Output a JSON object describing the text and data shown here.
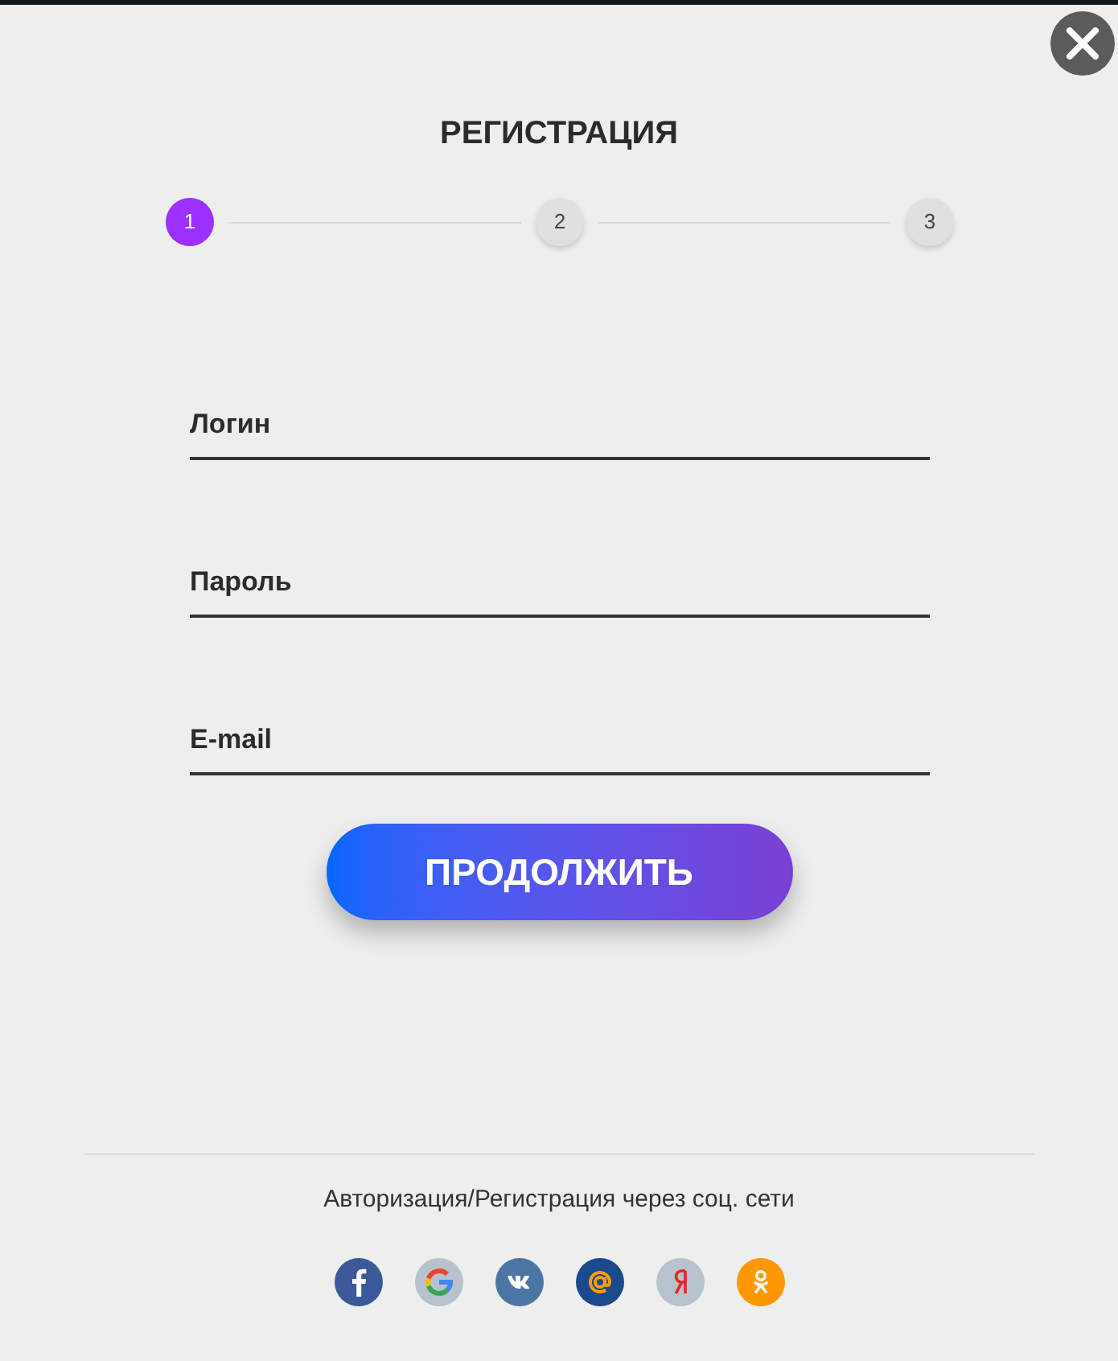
{
  "title": "РЕГИСТРАЦИЯ",
  "steps": [
    {
      "label": "1",
      "selected": true
    },
    {
      "label": "2",
      "selected": false
    },
    {
      "label": "3",
      "selected": false
    }
  ],
  "fields": [
    {
      "placeholder": "Логин"
    },
    {
      "placeholder": "Пароль"
    },
    {
      "placeholder": "E-mail"
    }
  ],
  "continue_button": {
    "label": "ПРОДОЛЖИТЬ"
  },
  "social_login": {
    "caption": "Авторизация/Регистрация через соц. сети",
    "providers": [
      {
        "kind": "facebook",
        "color": "#3b5998"
      },
      {
        "kind": "google",
        "color": "#b8c2cc"
      },
      {
        "kind": "vk",
        "color": "#4c75a3"
      },
      {
        "kind": "mail",
        "color": "#1b4a8c"
      },
      {
        "kind": "yandex",
        "color": "#b8c2cc"
      },
      {
        "kind": "ok",
        "color": "#ff9800"
      }
    ]
  }
}
